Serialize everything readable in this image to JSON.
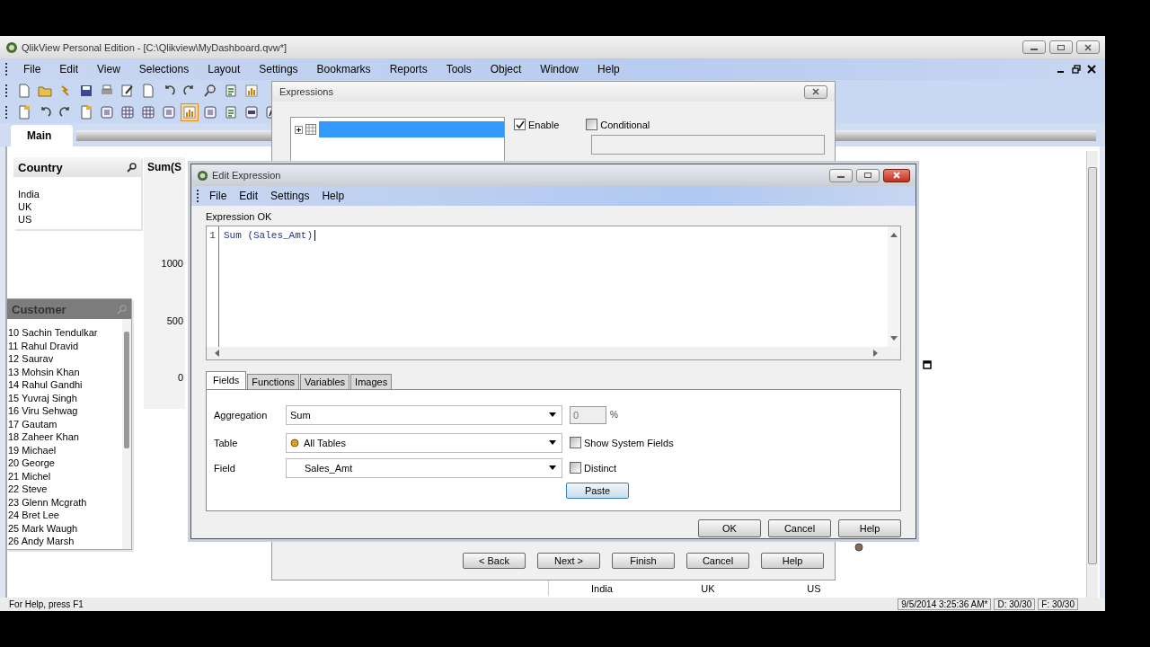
{
  "app": {
    "title": "QlikView Personal Edition - [C:\\Qlikview\\MyDashboard.qvw*]"
  },
  "menu": [
    "File",
    "Edit",
    "View",
    "Selections",
    "Layout",
    "Settings",
    "Bookmarks",
    "Reports",
    "Tools",
    "Object",
    "Window",
    "Help"
  ],
  "toolbars": [
    [
      {
        "kind": "page",
        "selected": false
      },
      {
        "kind": "folder",
        "selected": false
      },
      {
        "kind": "reload",
        "selected": false
      },
      {
        "kind": "save",
        "selected": false
      },
      {
        "kind": "print",
        "selected": false
      },
      {
        "kind": "edit",
        "selected": false
      },
      {
        "kind": "page",
        "selected": false
      },
      {
        "kind": "undo",
        "selected": false
      },
      {
        "kind": "redo",
        "selected": false
      },
      {
        "kind": "search",
        "selected": false
      },
      {
        "kind": "form",
        "selected": false
      },
      {
        "kind": "chart",
        "selected": false
      }
    ],
    [
      {
        "kind": "sheet",
        "selected": false
      },
      {
        "kind": "undo",
        "selected": false
      },
      {
        "kind": "redo",
        "selected": false
      },
      {
        "kind": "sheet",
        "selected": false
      },
      {
        "kind": "list",
        "selected": false
      },
      {
        "kind": "table",
        "selected": false
      },
      {
        "kind": "table",
        "selected": false
      },
      {
        "kind": "list",
        "selected": false
      },
      {
        "kind": "chart",
        "selected": true
      },
      {
        "kind": "list",
        "selected": false
      },
      {
        "kind": "form",
        "selected": false
      },
      {
        "kind": "button",
        "selected": false
      },
      {
        "kind": "text",
        "selected": false
      }
    ]
  ],
  "sheet_tabs": [
    {
      "label": "Main",
      "selected": true
    }
  ],
  "country_list": {
    "title": "Country",
    "items": [
      "India",
      "UK",
      "US"
    ]
  },
  "sum_chart": {
    "title": "Sum(S",
    "y_labels": [
      "1000",
      "500",
      "0"
    ]
  },
  "customer_list": {
    "title": "Customer",
    "items": [
      "10 Sachin Tendulkar",
      "11 Rahul Dravid",
      "12 Saurav",
      "13 Mohsin Khan",
      "14 Rahul Gandhi",
      "15 Yuvraj Singh",
      "16 Viru Sehwag",
      "17 Gautam",
      "18 Zaheer Khan",
      "19 Michael",
      "20 George",
      "21 Michel",
      "22 Steve",
      "23 Glenn Mcgrath",
      "24 Bret Lee",
      "25 Mark Waugh",
      "26 Andy Marsh"
    ]
  },
  "bottom_chart": {
    "x_labels": [
      "India",
      "UK",
      "US"
    ]
  },
  "status_bar": {
    "help": "For Help, press F1",
    "time": "9/5/2014 3:25:36 AM*",
    "d": "D: 30/30",
    "f": "F: 30/30"
  },
  "expressions_dialog": {
    "title": "Expressions",
    "rows": [
      {
        "selected": true,
        "expanded": false
      }
    ],
    "enable": {
      "label": "Enable",
      "checked": true
    },
    "conditional": {
      "label": "Conditional",
      "checked": false
    },
    "buttons": [
      "< Back",
      "Next >",
      "Finish",
      "Cancel",
      "Help"
    ]
  },
  "edit_dialog": {
    "title": "Edit Expression",
    "menu": [
      "File",
      "Edit",
      "Settings",
      "Help"
    ],
    "status": "Expression OK",
    "lines": [
      {
        "number": "1",
        "code": "Sum (Sales_Amt)"
      }
    ],
    "tabs": [
      {
        "label": "Fields",
        "selected": true
      },
      {
        "label": "Functions",
        "selected": false
      },
      {
        "label": "Variables",
        "selected": false
      },
      {
        "label": "Images",
        "selected": false
      }
    ],
    "aggregation": {
      "label": "Aggregation",
      "value": "Sum"
    },
    "percent": {
      "value": "0",
      "unit": "%",
      "disabled": true
    },
    "table": {
      "label": "Table",
      "value": "All Tables"
    },
    "field": {
      "label": "Field",
      "value": "Sales_Amt"
    },
    "show_system_fields": {
      "label": "Show System Fields",
      "checked": false
    },
    "distinct": {
      "label": "Distinct",
      "checked": false
    },
    "paste": "Paste",
    "buttons": [
      "OK",
      "Cancel",
      "Help"
    ]
  }
}
